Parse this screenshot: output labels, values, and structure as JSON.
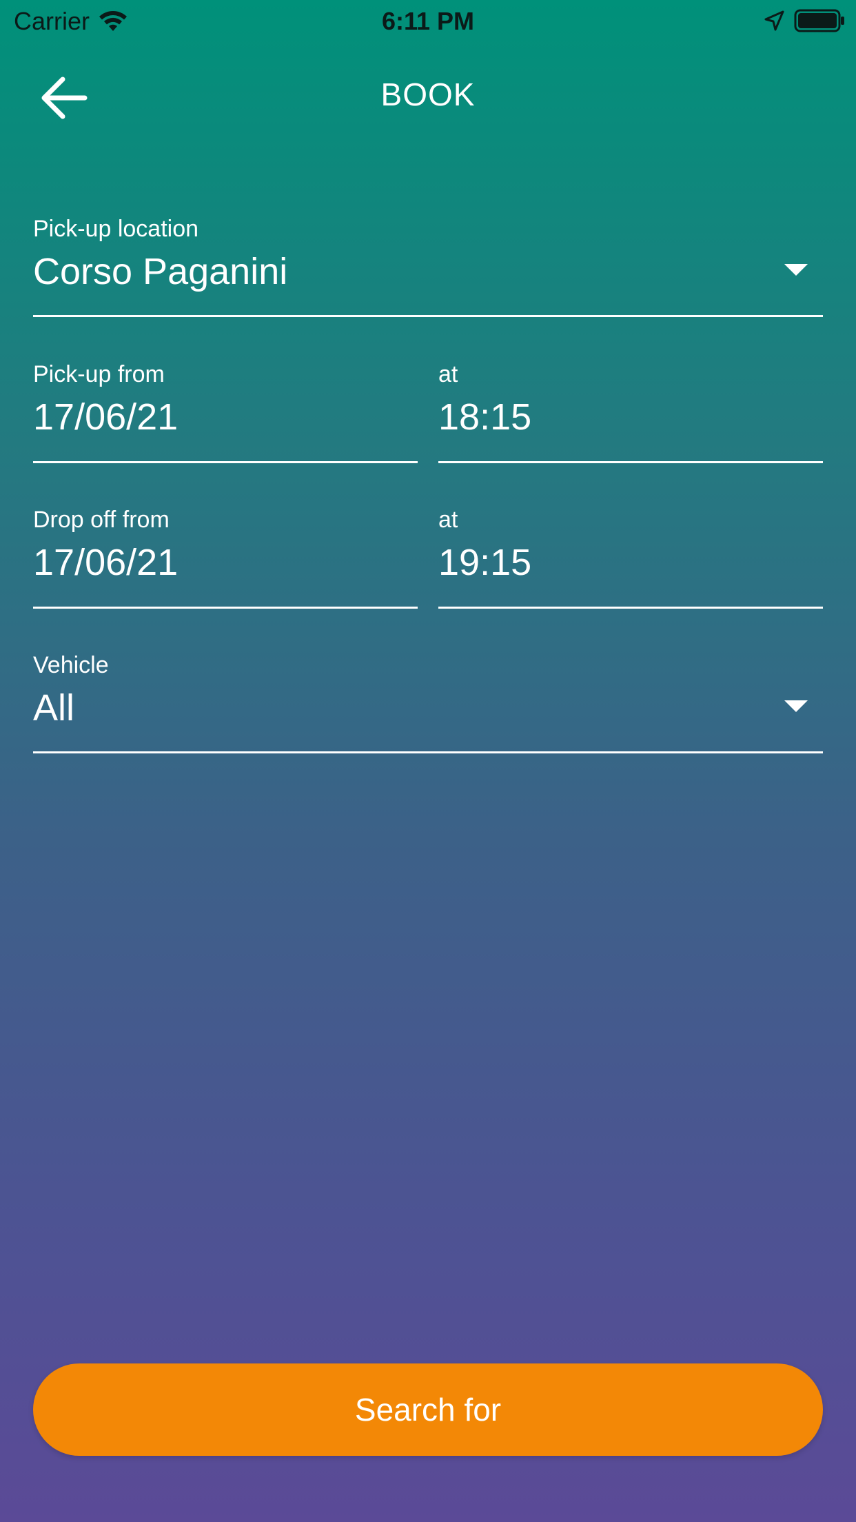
{
  "status_bar": {
    "carrier": "Carrier",
    "time": "6:11 PM",
    "icons": [
      "wifi-icon",
      "location-arrow-icon",
      "battery-icon"
    ]
  },
  "app_bar": {
    "title": "BOOK",
    "back_icon": "arrow-left-icon"
  },
  "form": {
    "pickup_location": {
      "label": "Pick-up location",
      "value": "Corso Paganini"
    },
    "pickup_date": {
      "label": "Pick-up from",
      "value": "17/06/21"
    },
    "pickup_time": {
      "label": "at",
      "value": "18:15"
    },
    "dropoff_date": {
      "label": "Drop off from",
      "value": "17/06/21"
    },
    "dropoff_time": {
      "label": "at",
      "value": "19:15"
    },
    "vehicle": {
      "label": "Vehicle",
      "value": "All"
    }
  },
  "search_button": {
    "label": "Search for"
  },
  "colors": {
    "gradient_top": "#00917a",
    "gradient_bottom": "#5b4a97",
    "accent": "#f38806",
    "text": "#ffffff"
  }
}
